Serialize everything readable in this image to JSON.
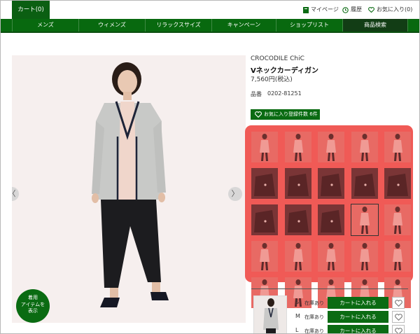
{
  "header": {
    "cart_label": "カート(0)",
    "mypage_label": "マイページ",
    "history_label": "履歴",
    "favorites_label": "お気に入り(0)"
  },
  "nav": {
    "items": [
      "メンズ",
      "ウィメンズ",
      "リラックスサイズ",
      "キャンペーン",
      "ショップリスト",
      "商品検索"
    ],
    "active_index": 5
  },
  "product": {
    "brand": "CROCODILE ChiC",
    "name": "Vネックカーディガン",
    "price": "7,560円(税込)",
    "sku_label": "品番",
    "sku_value": "0202-81251",
    "favorite_button": "お気に入り登録件数 6件",
    "wear_badge": "着用\nアイテムを\n表示"
  },
  "gallery": {
    "prev_arrow": "〈",
    "next_arrow": "〉",
    "thumbnail_count": 25,
    "selected_index": 13
  },
  "stock": {
    "rows": [
      {
        "size": "S",
        "status": "在庫あり",
        "button": "カートに入れる"
      },
      {
        "size": "M",
        "status": "在庫あり",
        "button": "カートに入れる"
      },
      {
        "size": "L",
        "status": "在庫あり",
        "button": "カートに入れる"
      }
    ]
  },
  "colors": {
    "brand_green": "#0b6b13",
    "highlight_overlay": "#f05a56"
  }
}
